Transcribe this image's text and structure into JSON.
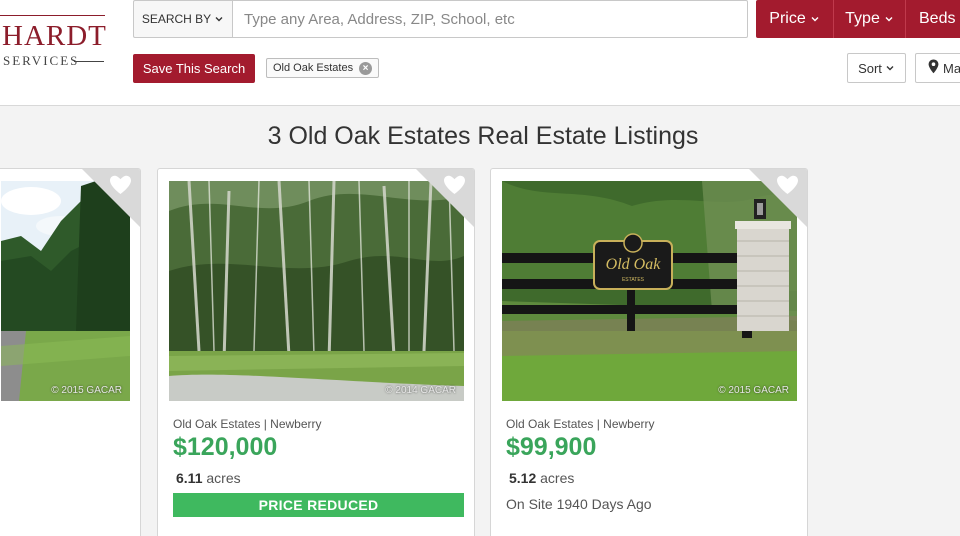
{
  "brand": {
    "logo_text": "HARDT",
    "logo_sub": "SERVICES"
  },
  "search": {
    "search_by_label": "SEARCH BY",
    "placeholder": "Type any Area, Address, ZIP, School, etc"
  },
  "filters": {
    "price_label": "Price",
    "type_label": "Type",
    "beds_label": "Beds"
  },
  "toolbar": {
    "save_search_label": "Save This Search",
    "active_tag": "Old Oak Estates",
    "sort_label": "Sort",
    "map_label": "Ma"
  },
  "page": {
    "title": "3 Old Oak Estates Real Estate Listings"
  },
  "colors": {
    "brand_red": "#a31b2e",
    "price_green": "#3aa55b",
    "reduced_green": "#3fb95f"
  },
  "listings": [
    {
      "copyright": "© 2015 GACAR"
    },
    {
      "copyright": "© 2014 GACAR",
      "location": "Old Oak Estates",
      "city": "Newberry",
      "price": "$120,000",
      "acres_value": "6.11",
      "acres_unit": "acres",
      "badge": "PRICE REDUCED"
    },
    {
      "copyright": "© 2015 GACAR",
      "location": "Old Oak Estates",
      "city": "Newberry",
      "price": "$99,900",
      "acres_value": "5.12",
      "acres_unit": "acres",
      "status": "On Site 1940 Days Ago",
      "sign_text": "Old Oak",
      "sign_sub": "ESTATES"
    }
  ],
  "icons": {
    "favorite": "heart-icon",
    "dropdown": "chevron-down-icon",
    "remove_tag": "close-circle-icon",
    "map": "map-pin-icon"
  }
}
